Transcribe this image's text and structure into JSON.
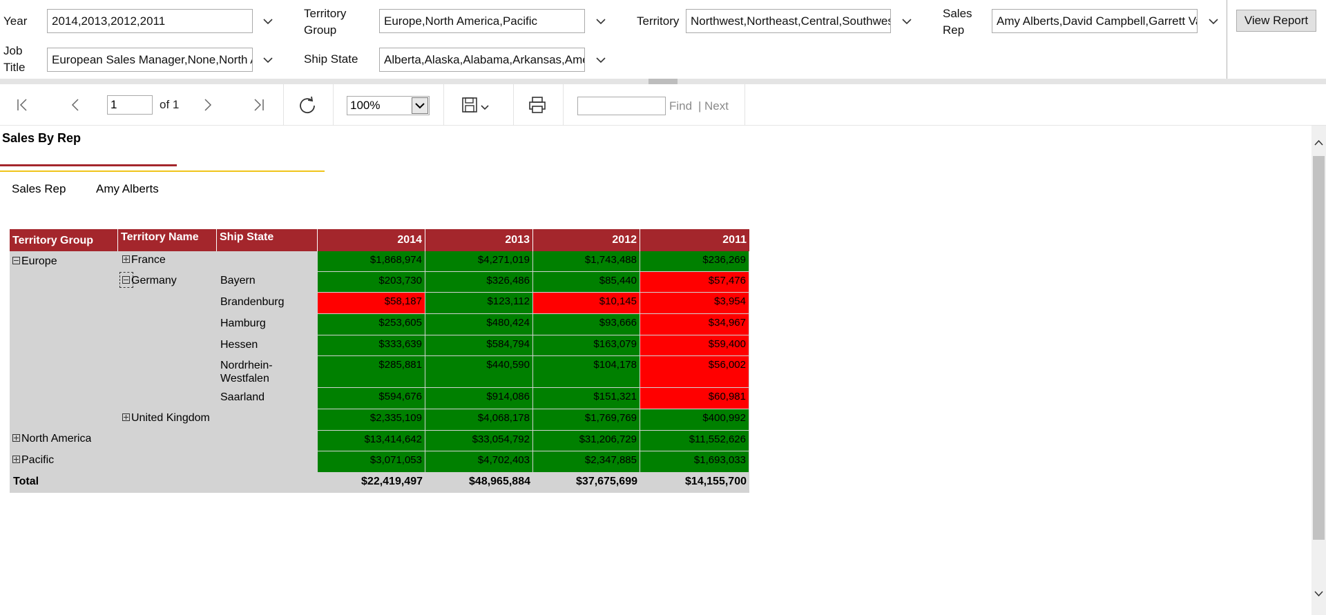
{
  "params": {
    "year_label": "Year",
    "year_value": "2014,2013,2012,2011",
    "territory_group_label": "Territory Group",
    "territory_group_value": "Europe,North America,Pacific",
    "territory_label": "Territory",
    "territory_value": "Northwest,Northeast,Central,Southwest",
    "sales_rep_label": "Sales Rep",
    "sales_rep_value": "Amy Alberts,David Campbell,Garrett Va",
    "job_title_label": "Job Title",
    "job_title_value": "European Sales Manager,None,North A",
    "ship_state_label": "Ship State",
    "ship_state_value": "Alberta,Alaska,Alabama,Arkansas,Amer",
    "view_report_label": "View Report"
  },
  "toolbar": {
    "page_value": "1",
    "page_of": "of 1",
    "zoom_value": "100%",
    "find_label": "Find",
    "next_label": "Next"
  },
  "report": {
    "title": "Sales By Rep",
    "sales_rep_label": "Sales Rep",
    "sales_rep_value": "Amy Alberts"
  },
  "table": {
    "headers": [
      "Territory Group",
      "Territory Name",
      "Ship State",
      "2014",
      "2013",
      "2012",
      "2011"
    ],
    "groups": {
      "europe": "Europe",
      "north_america": "North America",
      "pacific": "Pacific"
    },
    "territories": {
      "france": "France",
      "germany": "Germany",
      "uk": "United Kingdom"
    },
    "rows": [
      {
        "state": "",
        "values": [
          "$1,868,974",
          "$4,271,019",
          "$1,743,488",
          "$236,269"
        ],
        "colors": [
          "green",
          "green",
          "green",
          "green"
        ]
      },
      {
        "state": "Bayern",
        "values": [
          "$203,730",
          "$326,486",
          "$85,440",
          "$57,476"
        ],
        "colors": [
          "green",
          "green",
          "green",
          "red"
        ]
      },
      {
        "state": "Brandenburg",
        "values": [
          "$58,187",
          "$123,112",
          "$10,145",
          "$3,954"
        ],
        "colors": [
          "red",
          "green",
          "red",
          "red"
        ]
      },
      {
        "state": "Hamburg",
        "values": [
          "$253,605",
          "$480,424",
          "$93,666",
          "$34,967"
        ],
        "colors": [
          "green",
          "green",
          "green",
          "red"
        ]
      },
      {
        "state": "Hessen",
        "values": [
          "$333,639",
          "$584,794",
          "$163,079",
          "$59,400"
        ],
        "colors": [
          "green",
          "green",
          "green",
          "red"
        ]
      },
      {
        "state": "Nordrhein-Westfalen",
        "values": [
          "$285,881",
          "$440,590",
          "$104,178",
          "$56,002"
        ],
        "colors": [
          "green",
          "green",
          "green",
          "red"
        ]
      },
      {
        "state": "Saarland",
        "values": [
          "$594,676",
          "$914,086",
          "$151,321",
          "$60,981"
        ],
        "colors": [
          "green",
          "green",
          "green",
          "red"
        ]
      },
      {
        "state": "",
        "values": [
          "$2,335,109",
          "$4,068,178",
          "$1,769,769",
          "$400,992"
        ],
        "colors": [
          "green",
          "green",
          "green",
          "green"
        ]
      },
      {
        "state": "",
        "values": [
          "$13,414,642",
          "$33,054,792",
          "$31,206,729",
          "$11,552,626"
        ],
        "colors": [
          "green",
          "green",
          "green",
          "green"
        ]
      },
      {
        "state": "",
        "values": [
          "$3,071,053",
          "$4,702,403",
          "$2,347,885",
          "$1,693,033"
        ],
        "colors": [
          "green",
          "green",
          "green",
          "green"
        ]
      }
    ],
    "total_label": "Total",
    "totals": [
      "$22,419,497",
      "$48,965,884",
      "$37,675,699",
      "$14,155,700"
    ]
  },
  "colors": {
    "header_bg": "#a4262c",
    "good": "#008000",
    "bad": "#ff0000",
    "accent_line": "#f0c419"
  },
  "icons": [
    "first-page-icon",
    "previous-page-icon",
    "next-page-icon",
    "last-page-icon",
    "refresh-icon",
    "save-icon",
    "print-icon",
    "chevron-down-icon"
  ]
}
